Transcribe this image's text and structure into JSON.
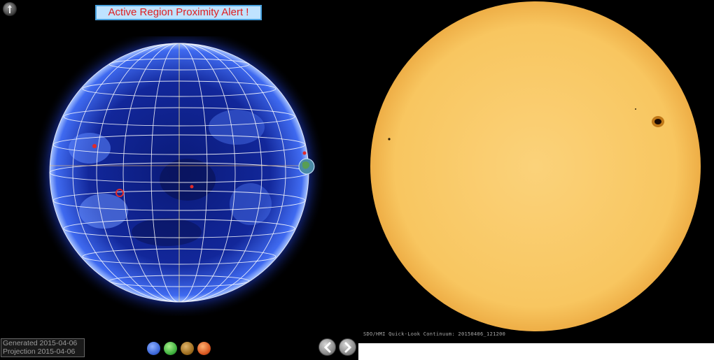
{
  "alert": {
    "text": "Active Region Proximity Alert !"
  },
  "meta": {
    "generated": "Generated 2015-04-06",
    "projection": "Projection  2015-04-06"
  },
  "wavelengths": [
    {
      "name": "wavelength-blue",
      "color": "#3a66d8"
    },
    {
      "name": "wavelength-green",
      "color": "#3cae3c"
    },
    {
      "name": "wavelength-brown",
      "color": "#9a6a1c"
    },
    {
      "name": "wavelength-orange",
      "color": "#d8551e"
    }
  ],
  "hmi": {
    "caption": "SDO/HMI Quick-Look Continuum: 20150406_121200"
  },
  "colors": {
    "accent_alert": "#e02020",
    "banner_bg": "#bfe3ff",
    "hmi_disk": "#f8c660"
  }
}
